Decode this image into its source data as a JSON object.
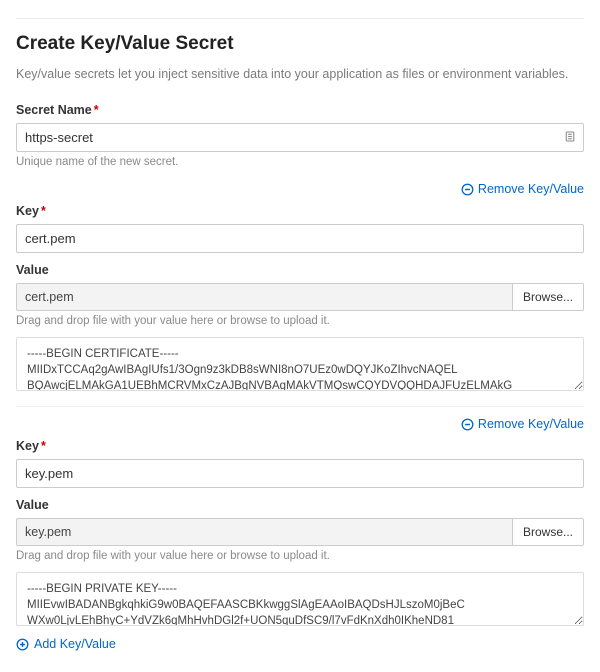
{
  "page": {
    "title": "Create Key/Value Secret",
    "subtitle": "Key/value secrets let you inject sensitive data into your application as files or environment variables."
  },
  "secret_name": {
    "label": "Secret Name",
    "value": "https-secret",
    "help": "Unique name of the new secret."
  },
  "labels": {
    "key": "Key",
    "value": "Value",
    "browse": "Browse...",
    "drag_help": "Drag and drop file with your value here or browse to upload it.",
    "remove": "Remove Key/Value",
    "add": "Add Key/Value"
  },
  "kv": [
    {
      "key": "cert.pem",
      "filename": "cert.pem",
      "content": "-----BEGIN CERTIFICATE-----\nMIIDxTCCAq2gAwIBAgIUfs1/3Ogn9z3kDB8sWNI8nO7UEz0wDQYJKoZIhvcNAQEL\nBQAwcjELMAkGA1UEBhMCRVMxCzAJBgNVBAgMAkVTMQswCQYDVQQHDAJFUzELMAkG"
    },
    {
      "key": "key.pem",
      "filename": "key.pem",
      "content": "-----BEGIN PRIVATE KEY-----\nMIIEvwIBADANBgkqhkiG9w0BAQEFAASCBKkwggSlAgEAAoIBAQDsHJLszoM0jBeC\nWXw0LjvLEhBhyC+YdVZk6qMhHvhDGl2f+UON5quDfSC9/l7vFdKnXdh0IKheND81"
    }
  ]
}
